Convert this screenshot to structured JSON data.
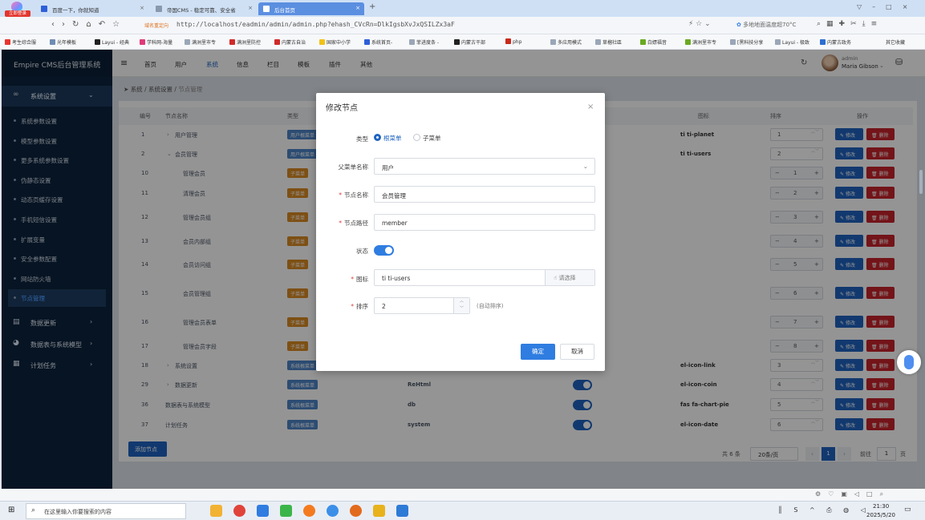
{
  "browser": {
    "tabs": [
      {
        "label": "百度一下，你就知道"
      },
      {
        "label": "帝国CMS - 稳定可靠、安全省"
      },
      {
        "label": "后台首页"
      }
    ],
    "login_button": "立即登录",
    "redirect_label": "域名重定向",
    "url": "http://localhost/eadmin/admin/admin.php?ehash_CVcRn=DlkIgsbXvJxQSILZx3aF",
    "weather": "多地地面温度超70°C",
    "bookmarks": [
      "考生综合服",
      "光年模板",
      "Layui - 经典",
      "学科网-海量",
      "满洲里市专",
      "满洲里防控",
      "内蒙古自治",
      "国家中小学",
      "系统首页-",
      "菲进度条 -",
      "内蒙古干部",
      "php",
      "多应用模式",
      "草榴社區",
      "白嫖福音",
      "满洲里市专",
      "[黑科技分享",
      "Layui - 极致",
      "内蒙古政务"
    ],
    "other_bookmarks": "其它收藏"
  },
  "app": {
    "brand": "Empire CMS后台管理系统",
    "nav": [
      "首页",
      "用户",
      "系统",
      "信息",
      "栏目",
      "模板",
      "插件",
      "其他"
    ],
    "active_nav": "系统",
    "user": {
      "role": "admin",
      "name": "Maria Gibson"
    }
  },
  "sidebar": {
    "group1": "系统设置",
    "items": [
      "系统参数设置",
      "模型参数设置",
      "更多系统参数设置",
      "伪静态设置",
      "动态页缓存设置",
      "手机短信设置",
      "扩展变量",
      "安全参数配置",
      "网站防火墙",
      "节点管理"
    ],
    "active_item": "节点管理",
    "groups": [
      "数据更新",
      "数据表与系统模型",
      "计划任务"
    ]
  },
  "breadcrumb": [
    "系统",
    "系统设置",
    "节点管理"
  ],
  "table": {
    "headers": [
      "编号",
      "节点名称",
      "类型",
      "图标",
      "排序",
      "操作"
    ],
    "edit_label": "修改",
    "delete_label": "删除",
    "rows": [
      {
        "id": "1",
        "name": "用户管理",
        "type": "用户根菜单",
        "icon": "ti ti-planet",
        "sort": "1",
        "level": 0,
        "expand": ">"
      },
      {
        "id": "2",
        "name": "会员管理",
        "type": "用户根菜单",
        "icon": "ti ti-users",
        "sort": "2",
        "level": 0,
        "expand": "v"
      },
      {
        "id": "10",
        "name": "管理会员",
        "type": "子菜单",
        "icon": "",
        "sort": "1",
        "level": 1,
        "expand": ""
      },
      {
        "id": "11",
        "name": "清理会员",
        "type": "子菜单",
        "icon": "",
        "sort": "2",
        "level": 1,
        "expand": ""
      },
      {
        "id": "12",
        "name": "管理会员组",
        "type": "子菜单",
        "icon": "",
        "sort": "3",
        "level": 1,
        "expand": ""
      },
      {
        "id": "13",
        "name": "会员内部组",
        "type": "子菜单",
        "icon": "",
        "sort": "4",
        "level": 1,
        "expand": ""
      },
      {
        "id": "14",
        "name": "会员访问组",
        "type": "子菜单",
        "icon": "",
        "sort": "5",
        "level": 1,
        "expand": ""
      },
      {
        "id": "15",
        "name": "会员管理组",
        "type": "子菜单",
        "icon": "",
        "sort": "6",
        "level": 1,
        "expand": ""
      },
      {
        "id": "16",
        "name": "管理会员表单",
        "type": "子菜单",
        "icon": "",
        "sort": "7",
        "level": 1,
        "expand": ""
      },
      {
        "id": "17",
        "name": "管理会员字段",
        "type": "子菜单",
        "icon": "",
        "sort": "8",
        "level": 1,
        "expand": ""
      },
      {
        "id": "18",
        "name": "系统设置",
        "type": "系统根菜单",
        "icon": "el-icon-link",
        "sort": "3",
        "level": 0,
        "expand": ">"
      },
      {
        "id": "29",
        "name": "数据更新",
        "type": "系统根菜单",
        "path": "ReHtml",
        "icon": "el-icon-coin",
        "sort": "4",
        "level": 0,
        "expand": ">"
      },
      {
        "id": "36",
        "name": "数据表与系统模型",
        "type": "系统根菜单",
        "path": "db",
        "icon": "fas fa-chart-pie",
        "sort": "5",
        "level": 0,
        "expand": ""
      },
      {
        "id": "37",
        "name": "计划任务",
        "type": "系统根菜单",
        "path": "system",
        "icon": "el-icon-date",
        "sort": "6",
        "level": 0,
        "expand": ""
      }
    ],
    "add_button": "添加节点",
    "pagination": {
      "total": "共 6 条",
      "page_size": "20条/页",
      "current": "1",
      "goto_label": "前往",
      "goto_value": "1",
      "page_suffix": "页"
    }
  },
  "modal": {
    "title": "修改节点",
    "type_label": "类型",
    "type_options": [
      "根菜单",
      "子菜单"
    ],
    "type_selected": "根菜单",
    "parent_label": "父菜单名称",
    "parent_value": "用户",
    "name_label": "节点名称",
    "name_value": "会员管理",
    "path_label": "节点路径",
    "path_value": "member",
    "status_label": "状态",
    "status_on": true,
    "icon_label": "图标",
    "icon_value": "ti ti-users",
    "icon_select": "请选择",
    "sort_label": "排序",
    "sort_value": "2",
    "sort_hint": "(自动排序)",
    "confirm": "确定",
    "cancel": "取消"
  },
  "taskbar": {
    "search_placeholder": "在这里输入你要搜索的内容",
    "time": "21:30",
    "date": "2025/5/20"
  },
  "colors": {
    "primary": "#1f63c0",
    "danger": "#c7242b",
    "sidebar": "#0c1f36",
    "sub_badge": "#d98a24",
    "root_badge": "#4c84c6"
  }
}
